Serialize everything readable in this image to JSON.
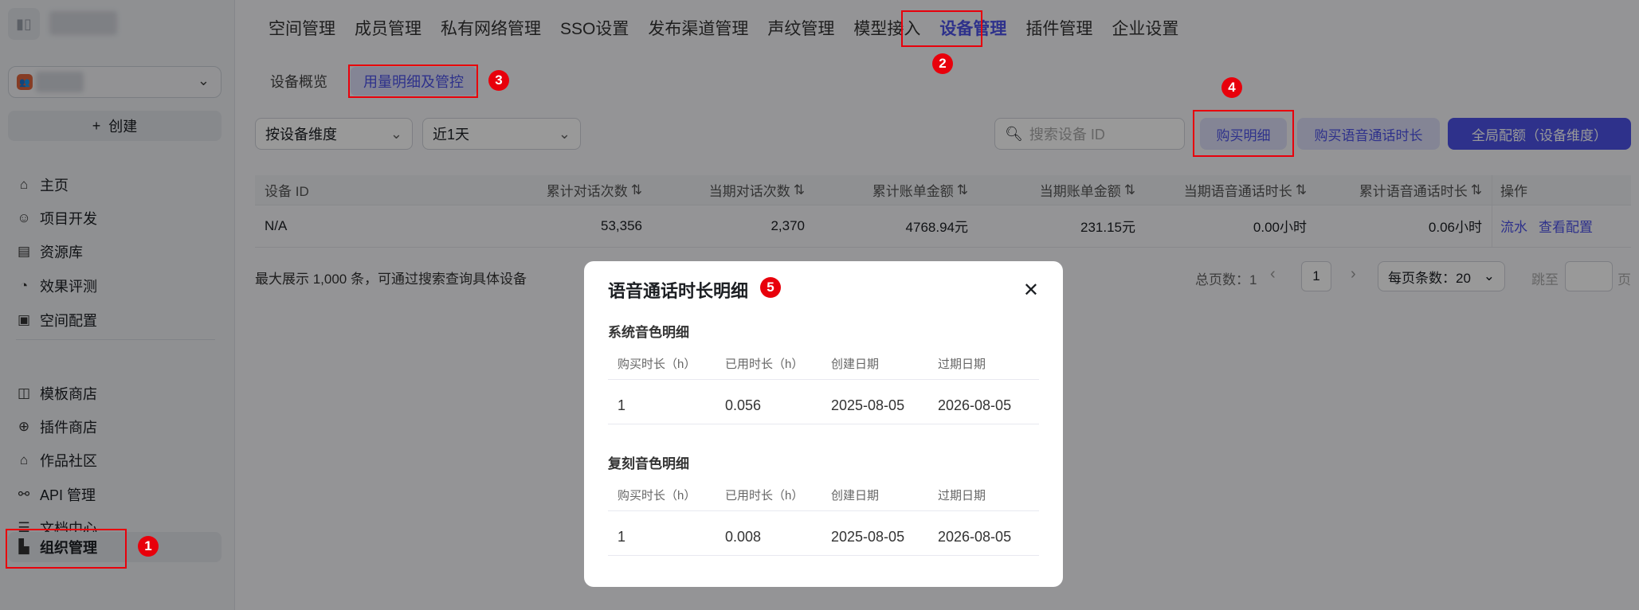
{
  "sidebar": {
    "create_label": "创建",
    "items": [
      {
        "label": "主页",
        "icon": "home-icon"
      },
      {
        "label": "项目开发",
        "icon": "robot-icon"
      },
      {
        "label": "资源库",
        "icon": "library-icon"
      },
      {
        "label": "效果评测",
        "icon": "gauge-icon"
      },
      {
        "label": "空间配置",
        "icon": "terminal-icon"
      },
      {
        "label": "模板商店",
        "icon": "template-icon"
      },
      {
        "label": "插件商店",
        "icon": "plugin-icon"
      },
      {
        "label": "作品社区",
        "icon": "community-icon"
      },
      {
        "label": "API 管理",
        "icon": "api-icon"
      },
      {
        "label": "文档中心",
        "icon": "document-icon"
      },
      {
        "label": "组织管理",
        "icon": "organization-icon",
        "active": true
      }
    ]
  },
  "topnav": [
    "空间管理",
    "成员管理",
    "私有网络管理",
    "SSO设置",
    "发布渠道管理",
    "声纹管理",
    "模型接入",
    "设备管理",
    "插件管理",
    "企业设置"
  ],
  "topnav_active": "设备管理",
  "subtabs": [
    "设备概览",
    "用量明细及管控"
  ],
  "filters": {
    "dimension": "按设备维度",
    "range": "近1天",
    "search_placeholder": "搜索设备 ID"
  },
  "buttons": {
    "purchase_detail": "购买明细",
    "buy_voice": "购买语音通话时长",
    "global_quota": "全局配额（设备维度）"
  },
  "table": {
    "headers": [
      "设备 ID",
      "累计对话次数",
      "当期对话次数",
      "累计账单金额",
      "当期账单金额",
      "当期语音通话时长",
      "累计语音通话时长",
      "操作"
    ],
    "sort_icon": "⇅",
    "rows": [
      [
        "N/A",
        "53,356",
        "2,370",
        "4768.94元",
        "231.15元",
        "0.00小时",
        "0.06小时"
      ]
    ],
    "actions": [
      "流水",
      "查看配置"
    ]
  },
  "note": "最大展示 1,000 条，可通过搜索查询具体设备",
  "pagination": {
    "total": "总页数：1",
    "page": "1",
    "page_size": "每页条数：20",
    "jump": "跳至",
    "page_suffix": "页"
  },
  "modal": {
    "title": "语音通话时长明细",
    "sections": [
      {
        "title": "系统音色明细",
        "headers": [
          "购买时长（h）",
          "已用时长（h）",
          "创建日期",
          "过期日期"
        ],
        "row": [
          "1",
          "0.056",
          "2025-08-05",
          "2026-08-05"
        ]
      },
      {
        "title": "复刻音色明细",
        "headers": [
          "购买时长（h）",
          "已用时长（h）",
          "创建日期",
          "过期日期"
        ],
        "row": [
          "1",
          "0.008",
          "2025-08-05",
          "2026-08-05"
        ]
      }
    ]
  },
  "annotations": [
    "1",
    "2",
    "3",
    "4",
    "5"
  ],
  "colors": {
    "accent": "#4d53e8",
    "annotation": "#e8000b"
  }
}
